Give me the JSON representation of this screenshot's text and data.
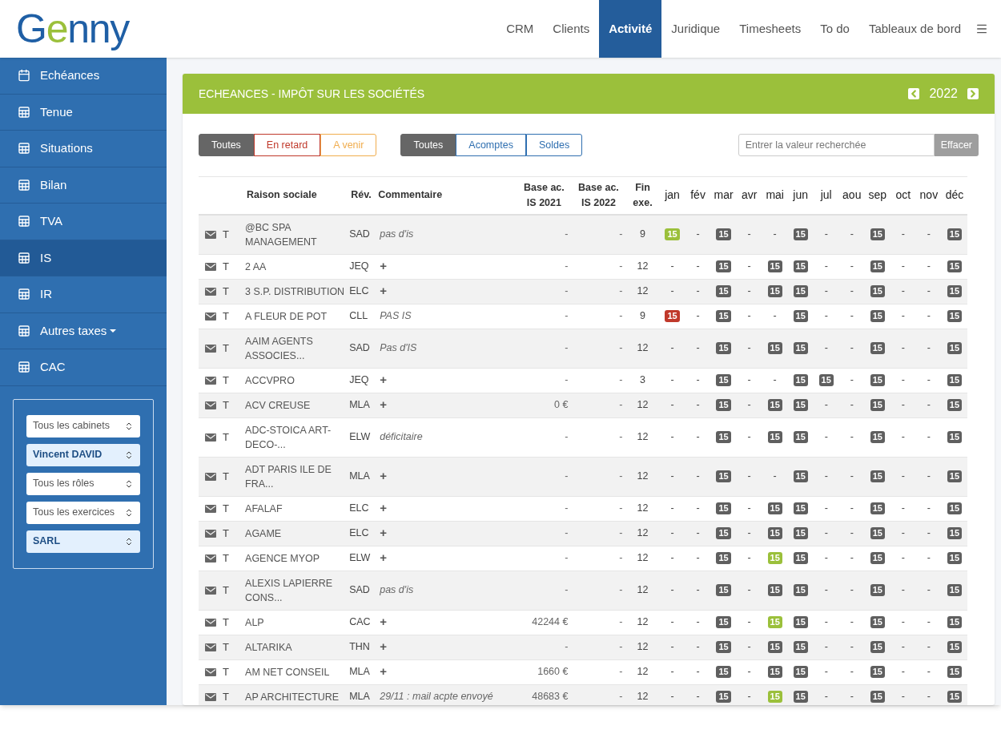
{
  "logo": "Genny",
  "nav": [
    {
      "label": "CRM",
      "selected": false
    },
    {
      "label": "Clients",
      "selected": false
    },
    {
      "label": "Activité",
      "selected": true
    },
    {
      "label": "Juridique",
      "selected": false
    },
    {
      "label": "Timesheets",
      "selected": false
    },
    {
      "label": "To do",
      "selected": false
    },
    {
      "label": "Tableaux de bord",
      "selected": false
    }
  ],
  "sidebar": {
    "items": [
      {
        "label": "Echéances",
        "kind": "calendar",
        "selected": false,
        "dropdown": false
      },
      {
        "label": "Tenue",
        "kind": "table",
        "selected": false,
        "dropdown": false
      },
      {
        "label": "Situations",
        "kind": "table",
        "selected": false,
        "dropdown": false
      },
      {
        "label": "Bilan",
        "kind": "table",
        "selected": false,
        "dropdown": false
      },
      {
        "label": "TVA",
        "kind": "table",
        "selected": false,
        "dropdown": false
      },
      {
        "label": "IS",
        "kind": "table",
        "selected": true,
        "dropdown": false
      },
      {
        "label": "IR",
        "kind": "table",
        "selected": false,
        "dropdown": false
      },
      {
        "label": "Autres taxes",
        "kind": "table",
        "selected": false,
        "dropdown": true
      },
      {
        "label": "CAC",
        "kind": "table",
        "selected": false,
        "dropdown": false
      }
    ],
    "filters": [
      {
        "value": "Tous les cabinets",
        "active": false
      },
      {
        "value": "Vincent DAVID",
        "active": true
      },
      {
        "value": "Tous les rôles",
        "active": false
      },
      {
        "value": "Tous les exercices",
        "active": false
      },
      {
        "value": "SARL",
        "active": true
      }
    ]
  },
  "panel": {
    "title": "ECHEANCES - IMPÔT SUR LES SOCIÉTÉS",
    "year": "2022",
    "status_filter": [
      {
        "label": "Toutes",
        "kind": "all",
        "selected": true
      },
      {
        "label": "En retard",
        "kind": "late",
        "selected": false
      },
      {
        "label": "A venir",
        "kind": "upcoming",
        "selected": false
      }
    ],
    "type_filter": [
      {
        "label": "Toutes",
        "selected": true
      },
      {
        "label": "Acomptes",
        "selected": false
      },
      {
        "label": "Soldes",
        "selected": false
      }
    ],
    "search": {
      "placeholder": "Entrer la valeur recherchée",
      "button": "Effacer"
    },
    "table": {
      "columns": [
        "Raison sociale",
        "Rév.",
        "Commentaire",
        "Base ac. IS 2021",
        "Base ac. IS 2022",
        "Fin exe."
      ],
      "months": [
        "jan",
        "fév",
        "mar",
        "avr",
        "mai",
        "jun",
        "jul",
        "aou",
        "sep",
        "oct",
        "nov",
        "déc"
      ],
      "rows": [
        {
          "type": "T",
          "name": "@BC SPA MANAGEMENT",
          "rev": "SAD",
          "comment": {
            "kind": "note",
            "text": "pas d'is"
          },
          "base_2021": "-",
          "base_2022": "-",
          "fin": "9",
          "months": [
            {
              "text": "15",
              "color": "#9bc03b"
            },
            {
              "text": "-"
            },
            {
              "text": "15",
              "color": "#5f5f5f"
            },
            {
              "text": "-"
            },
            {
              "text": "-"
            },
            {
              "text": "15",
              "color": "#5f5f5f"
            },
            {
              "text": "-"
            },
            {
              "text": "-"
            },
            {
              "text": "15",
              "color": "#5f5f5f"
            },
            {
              "text": "-"
            },
            {
              "text": "-"
            },
            {
              "text": "15",
              "color": "#5f5f5f"
            }
          ]
        },
        {
          "type": "T",
          "name": "2 AA",
          "rev": "JEQ",
          "comment": {
            "kind": "add",
            "text": "+"
          },
          "base_2021": "-",
          "base_2022": "-",
          "fin": "12",
          "months": [
            {
              "text": "-"
            },
            {
              "text": "-"
            },
            {
              "text": "15",
              "color": "#5f5f5f"
            },
            {
              "text": "-"
            },
            {
              "text": "15",
              "color": "#5f5f5f"
            },
            {
              "text": "15",
              "color": "#5f5f5f"
            },
            {
              "text": "-"
            },
            {
              "text": "-"
            },
            {
              "text": "15",
              "color": "#5f5f5f"
            },
            {
              "text": "-"
            },
            {
              "text": "-"
            },
            {
              "text": "15",
              "color": "#5f5f5f"
            }
          ]
        },
        {
          "type": "T",
          "name": "3 S.P. DISTRIBUTION",
          "rev": "ELC",
          "comment": {
            "kind": "add",
            "text": "+"
          },
          "base_2021": "-",
          "base_2022": "-",
          "fin": "12",
          "months": [
            {
              "text": "-"
            },
            {
              "text": "-"
            },
            {
              "text": "15",
              "color": "#5f5f5f"
            },
            {
              "text": "-"
            },
            {
              "text": "15",
              "color": "#5f5f5f"
            },
            {
              "text": "15",
              "color": "#5f5f5f"
            },
            {
              "text": "-"
            },
            {
              "text": "-"
            },
            {
              "text": "15",
              "color": "#5f5f5f"
            },
            {
              "text": "-"
            },
            {
              "text": "-"
            },
            {
              "text": "15",
              "color": "#5f5f5f"
            }
          ]
        },
        {
          "type": "T",
          "name": "A FLEUR DE POT",
          "rev": "CLL",
          "comment": {
            "kind": "note",
            "text": "PAS IS"
          },
          "base_2021": "-",
          "base_2022": "-",
          "fin": "9",
          "months": [
            {
              "text": "15",
              "color": "#c0392b"
            },
            {
              "text": "-"
            },
            {
              "text": "15",
              "color": "#5f5f5f"
            },
            {
              "text": "-"
            },
            {
              "text": "-"
            },
            {
              "text": "15",
              "color": "#5f5f5f"
            },
            {
              "text": "-"
            },
            {
              "text": "-"
            },
            {
              "text": "15",
              "color": "#5f5f5f"
            },
            {
              "text": "-"
            },
            {
              "text": "-"
            },
            {
              "text": "15",
              "color": "#5f5f5f"
            }
          ]
        },
        {
          "type": "T",
          "name": "AAIM AGENTS ASSOCIES...",
          "rev": "SAD",
          "comment": {
            "kind": "note",
            "text": "Pas d'IS"
          },
          "base_2021": "-",
          "base_2022": "-",
          "fin": "12",
          "months": [
            {
              "text": "-"
            },
            {
              "text": "-"
            },
            {
              "text": "15",
              "color": "#5f5f5f"
            },
            {
              "text": "-"
            },
            {
              "text": "15",
              "color": "#5f5f5f"
            },
            {
              "text": "15",
              "color": "#5f5f5f"
            },
            {
              "text": "-"
            },
            {
              "text": "-"
            },
            {
              "text": "15",
              "color": "#5f5f5f"
            },
            {
              "text": "-"
            },
            {
              "text": "-"
            },
            {
              "text": "15",
              "color": "#5f5f5f"
            }
          ]
        },
        {
          "type": "T",
          "name": "ACCVPRO",
          "rev": "JEQ",
          "comment": {
            "kind": "add",
            "text": "+"
          },
          "base_2021": "-",
          "base_2022": "-",
          "fin": "3",
          "months": [
            {
              "text": "-"
            },
            {
              "text": "-"
            },
            {
              "text": "15",
              "color": "#5f5f5f"
            },
            {
              "text": "-"
            },
            {
              "text": "-"
            },
            {
              "text": "15",
              "color": "#5f5f5f"
            },
            {
              "text": "15",
              "color": "#5f5f5f"
            },
            {
              "text": "-"
            },
            {
              "text": "15",
              "color": "#5f5f5f"
            },
            {
              "text": "-"
            },
            {
              "text": "-"
            },
            {
              "text": "15",
              "color": "#5f5f5f"
            }
          ]
        },
        {
          "type": "T",
          "name": "ACV CREUSE",
          "rev": "MLA",
          "comment": {
            "kind": "add",
            "text": "+"
          },
          "base_2021": "0 €",
          "base_2022": "-",
          "fin": "12",
          "months": [
            {
              "text": "-"
            },
            {
              "text": "-"
            },
            {
              "text": "15",
              "color": "#5f5f5f"
            },
            {
              "text": "-"
            },
            {
              "text": "15",
              "color": "#5f5f5f"
            },
            {
              "text": "15",
              "color": "#5f5f5f"
            },
            {
              "text": "-"
            },
            {
              "text": "-"
            },
            {
              "text": "15",
              "color": "#5f5f5f"
            },
            {
              "text": "-"
            },
            {
              "text": "-"
            },
            {
              "text": "15",
              "color": "#5f5f5f"
            }
          ]
        },
        {
          "type": "T",
          "name": "ADC-STOICA ART-DECO-...",
          "rev": "ELW",
          "comment": {
            "kind": "note",
            "text": "déficitaire"
          },
          "base_2021": "-",
          "base_2022": "-",
          "fin": "12",
          "months": [
            {
              "text": "-"
            },
            {
              "text": "-"
            },
            {
              "text": "15",
              "color": "#5f5f5f"
            },
            {
              "text": "-"
            },
            {
              "text": "15",
              "color": "#5f5f5f"
            },
            {
              "text": "15",
              "color": "#5f5f5f"
            },
            {
              "text": "-"
            },
            {
              "text": "-"
            },
            {
              "text": "15",
              "color": "#5f5f5f"
            },
            {
              "text": "-"
            },
            {
              "text": "-"
            },
            {
              "text": "15",
              "color": "#5f5f5f"
            }
          ]
        },
        {
          "type": "T",
          "name": "ADT PARIS ILE DE FRA...",
          "rev": "MLA",
          "comment": {
            "kind": "add",
            "text": "+"
          },
          "base_2021": "-",
          "base_2022": "-",
          "fin": "12",
          "months": [
            {
              "text": "-"
            },
            {
              "text": "-"
            },
            {
              "text": "15",
              "color": "#5f5f5f"
            },
            {
              "text": "-"
            },
            {
              "text": "-"
            },
            {
              "text": "15",
              "color": "#5f5f5f"
            },
            {
              "text": "-"
            },
            {
              "text": "-"
            },
            {
              "text": "15",
              "color": "#5f5f5f"
            },
            {
              "text": "-"
            },
            {
              "text": "-"
            },
            {
              "text": "15",
              "color": "#5f5f5f"
            }
          ]
        },
        {
          "type": "T",
          "name": "AFALAF",
          "rev": "ELC",
          "comment": {
            "kind": "add",
            "text": "+"
          },
          "base_2021": "-",
          "base_2022": "-",
          "fin": "12",
          "months": [
            {
              "text": "-"
            },
            {
              "text": "-"
            },
            {
              "text": "15",
              "color": "#5f5f5f"
            },
            {
              "text": "-"
            },
            {
              "text": "15",
              "color": "#5f5f5f"
            },
            {
              "text": "15",
              "color": "#5f5f5f"
            },
            {
              "text": "-"
            },
            {
              "text": "-"
            },
            {
              "text": "15",
              "color": "#5f5f5f"
            },
            {
              "text": "-"
            },
            {
              "text": "-"
            },
            {
              "text": "15",
              "color": "#5f5f5f"
            }
          ]
        },
        {
          "type": "T",
          "name": "AGAME",
          "rev": "ELC",
          "comment": {
            "kind": "add",
            "text": "+"
          },
          "base_2021": "-",
          "base_2022": "-",
          "fin": "12",
          "months": [
            {
              "text": "-"
            },
            {
              "text": "-"
            },
            {
              "text": "15",
              "color": "#5f5f5f"
            },
            {
              "text": "-"
            },
            {
              "text": "15",
              "color": "#5f5f5f"
            },
            {
              "text": "15",
              "color": "#5f5f5f"
            },
            {
              "text": "-"
            },
            {
              "text": "-"
            },
            {
              "text": "15",
              "color": "#5f5f5f"
            },
            {
              "text": "-"
            },
            {
              "text": "-"
            },
            {
              "text": "15",
              "color": "#5f5f5f"
            }
          ]
        },
        {
          "type": "T",
          "name": "AGENCE MYOP",
          "rev": "ELW",
          "comment": {
            "kind": "add",
            "text": "+"
          },
          "base_2021": "-",
          "base_2022": "-",
          "fin": "12",
          "months": [
            {
              "text": "-"
            },
            {
              "text": "-"
            },
            {
              "text": "15",
              "color": "#5f5f5f"
            },
            {
              "text": "-"
            },
            {
              "text": "15",
              "color": "#9bc03b"
            },
            {
              "text": "15",
              "color": "#5f5f5f"
            },
            {
              "text": "-"
            },
            {
              "text": "-"
            },
            {
              "text": "15",
              "color": "#5f5f5f"
            },
            {
              "text": "-"
            },
            {
              "text": "-"
            },
            {
              "text": "15",
              "color": "#5f5f5f"
            }
          ]
        },
        {
          "type": "T",
          "name": "ALEXIS LAPIERRE CONS...",
          "rev": "SAD",
          "comment": {
            "kind": "note",
            "text": "pas d'is"
          },
          "base_2021": "-",
          "base_2022": "-",
          "fin": "12",
          "months": [
            {
              "text": "-"
            },
            {
              "text": "-"
            },
            {
              "text": "15",
              "color": "#5f5f5f"
            },
            {
              "text": "-"
            },
            {
              "text": "15",
              "color": "#5f5f5f"
            },
            {
              "text": "15",
              "color": "#5f5f5f"
            },
            {
              "text": "-"
            },
            {
              "text": "-"
            },
            {
              "text": "15",
              "color": "#5f5f5f"
            },
            {
              "text": "-"
            },
            {
              "text": "-"
            },
            {
              "text": "15",
              "color": "#5f5f5f"
            }
          ]
        },
        {
          "type": "T",
          "name": "ALP",
          "rev": "CAC",
          "comment": {
            "kind": "add",
            "text": "+"
          },
          "base_2021": "42244 €",
          "base_2022": "-",
          "fin": "12",
          "months": [
            {
              "text": "-"
            },
            {
              "text": "-"
            },
            {
              "text": "15",
              "color": "#5f5f5f"
            },
            {
              "text": "-"
            },
            {
              "text": "15",
              "color": "#9bc03b"
            },
            {
              "text": "15",
              "color": "#5f5f5f"
            },
            {
              "text": "-"
            },
            {
              "text": "-"
            },
            {
              "text": "15",
              "color": "#5f5f5f"
            },
            {
              "text": "-"
            },
            {
              "text": "-"
            },
            {
              "text": "15",
              "color": "#5f5f5f"
            }
          ]
        },
        {
          "type": "T",
          "name": "ALTARIKA",
          "rev": "THN",
          "comment": {
            "kind": "add",
            "text": "+"
          },
          "base_2021": "-",
          "base_2022": "-",
          "fin": "12",
          "months": [
            {
              "text": "-"
            },
            {
              "text": "-"
            },
            {
              "text": "15",
              "color": "#5f5f5f"
            },
            {
              "text": "-"
            },
            {
              "text": "15",
              "color": "#5f5f5f"
            },
            {
              "text": "15",
              "color": "#5f5f5f"
            },
            {
              "text": "-"
            },
            {
              "text": "-"
            },
            {
              "text": "15",
              "color": "#5f5f5f"
            },
            {
              "text": "-"
            },
            {
              "text": "-"
            },
            {
              "text": "15",
              "color": "#5f5f5f"
            }
          ]
        },
        {
          "type": "T",
          "name": "AM NET CONSEIL",
          "rev": "MLA",
          "comment": {
            "kind": "add",
            "text": "+"
          },
          "base_2021": "1660 €",
          "base_2022": "-",
          "fin": "12",
          "months": [
            {
              "text": "-"
            },
            {
              "text": "-"
            },
            {
              "text": "15",
              "color": "#5f5f5f"
            },
            {
              "text": "-"
            },
            {
              "text": "15",
              "color": "#5f5f5f"
            },
            {
              "text": "15",
              "color": "#5f5f5f"
            },
            {
              "text": "-"
            },
            {
              "text": "-"
            },
            {
              "text": "15",
              "color": "#5f5f5f"
            },
            {
              "text": "-"
            },
            {
              "text": "-"
            },
            {
              "text": "15",
              "color": "#5f5f5f"
            }
          ]
        },
        {
          "type": "T",
          "name": "AP ARCHITECTURE",
          "rev": "MLA",
          "comment": {
            "kind": "note",
            "text": "29/11 : mail acpte envoyé"
          },
          "base_2021": "48683 €",
          "base_2022": "-",
          "fin": "12",
          "months": [
            {
              "text": "-"
            },
            {
              "text": "-"
            },
            {
              "text": "15",
              "color": "#5f5f5f"
            },
            {
              "text": "-"
            },
            {
              "text": "15",
              "color": "#9bc03b"
            },
            {
              "text": "15",
              "color": "#5f5f5f"
            },
            {
              "text": "-"
            },
            {
              "text": "-"
            },
            {
              "text": "15",
              "color": "#5f5f5f"
            },
            {
              "text": "-"
            },
            {
              "text": "-"
            },
            {
              "text": "15",
              "color": "#5f5f5f"
            }
          ]
        }
      ]
    }
  }
}
